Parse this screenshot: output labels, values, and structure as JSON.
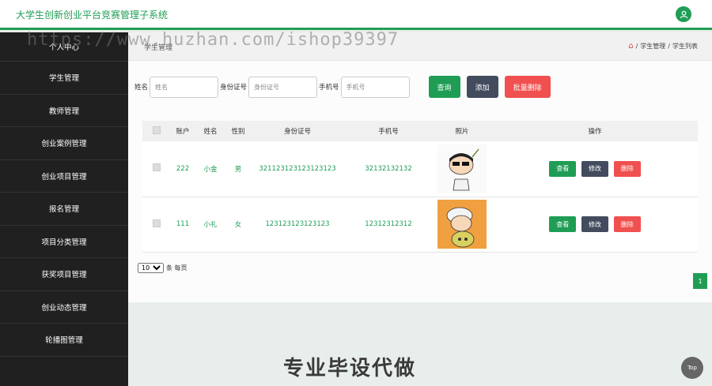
{
  "header": {
    "title": "大学生创新创业平台竞赛管理子系统"
  },
  "watermark": "https://www.huzhan.com/ishop39397",
  "sidebar": {
    "items": [
      {
        "label": "个人中心"
      },
      {
        "label": "学生管理"
      },
      {
        "label": "教师管理"
      },
      {
        "label": "创业案例管理"
      },
      {
        "label": "创业项目管理"
      },
      {
        "label": "报名管理"
      },
      {
        "label": "项目分类管理"
      },
      {
        "label": "获奖项目管理"
      },
      {
        "label": "创业动态管理"
      },
      {
        "label": "轮播图管理"
      }
    ]
  },
  "page": {
    "heading": "学生管理",
    "breadcrumb": [
      "学生管理",
      "学生列表"
    ]
  },
  "search": {
    "name_label": "姓名",
    "name_placeholder": "姓名",
    "id_label": "身份证号",
    "id_placeholder": "身份证号",
    "phone_label": "手机号",
    "phone_placeholder": "手机号",
    "query_label": "查询",
    "add_label": "添加",
    "batch_delete_label": "批量删除"
  },
  "table": {
    "headers": [
      "账户",
      "姓名",
      "性别",
      "身份证号",
      "手机号",
      "照片",
      "操作"
    ],
    "rows": [
      {
        "account": "222",
        "name": "小金",
        "gender": "男",
        "id_number": "321123123123123123",
        "phone": "32132132132"
      },
      {
        "account": "111",
        "name": "小礼",
        "gender": "女",
        "id_number": "123123123123123",
        "phone": "12312312312"
      }
    ],
    "actions": {
      "view": "查看",
      "edit": "修改",
      "delete": "删除"
    }
  },
  "pager": {
    "page_size": "10",
    "suffix": "条 每页",
    "current_page": "1"
  },
  "banner": "专业毕设代做",
  "top_button": "Top",
  "colors": {
    "accent": "#1f9d55",
    "danger": "#f05050",
    "dark": "#434b5e",
    "sidebar": "#202020"
  }
}
